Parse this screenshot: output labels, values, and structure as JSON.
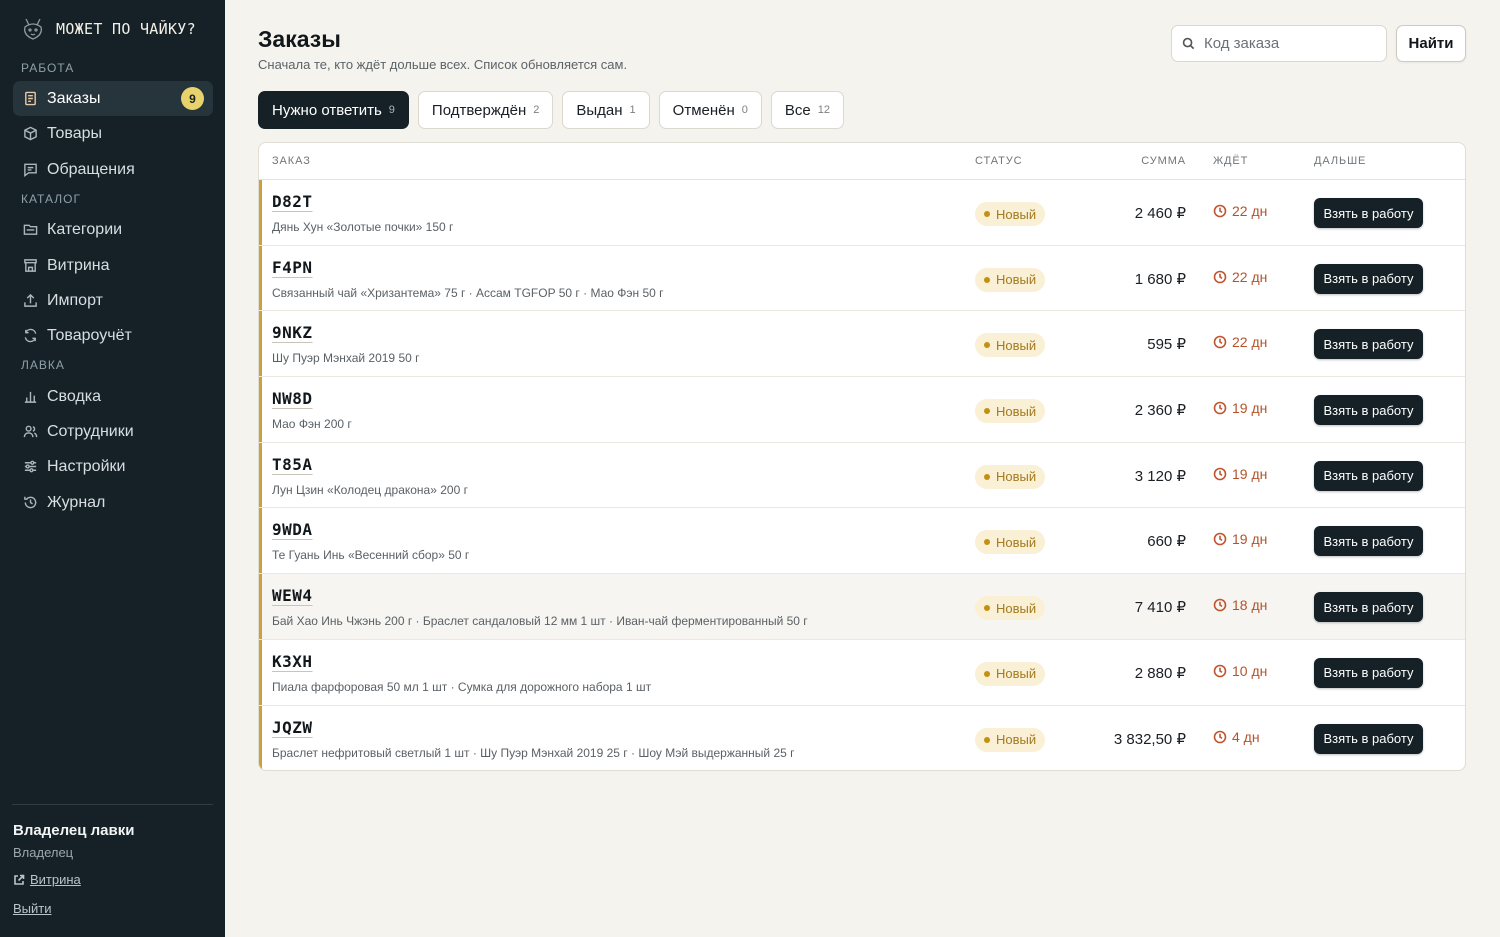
{
  "brand": {
    "name": "Может по чайку?"
  },
  "sidebar": {
    "sections": [
      {
        "title": "Работа"
      },
      {
        "title": "Каталог"
      },
      {
        "title": "Лавка"
      }
    ],
    "items": [
      {
        "label": "Заказы",
        "icon": "receipt-icon",
        "badge": "9",
        "active": true
      },
      {
        "label": "Товары",
        "icon": "box-icon"
      },
      {
        "label": "Обращения",
        "icon": "chat-icon"
      },
      {
        "label": "Категории",
        "icon": "folder-icon"
      },
      {
        "label": "Витрина",
        "icon": "storefront-icon"
      },
      {
        "label": "Импорт",
        "icon": "upload-icon"
      },
      {
        "label": "Товароучёт",
        "icon": "sync-icon"
      },
      {
        "label": "Сводка",
        "icon": "bar-chart-icon"
      },
      {
        "label": "Сотрудники",
        "icon": "users-icon"
      },
      {
        "label": "Настройки",
        "icon": "sliders-icon"
      },
      {
        "label": "Журнал",
        "icon": "history-icon"
      }
    ],
    "user": {
      "name": "Владелец лавки",
      "role": "Владелец"
    },
    "storefront_link": "Витрина",
    "logout_link": "Выйти"
  },
  "header": {
    "title": "Заказы",
    "subtitle": "Сначала те, кто ждёт дольше всех. Список обновляется сам.",
    "search_placeholder": "Код заказа",
    "search_button": "Найти"
  },
  "tabs": [
    {
      "label": "Нужно ответить",
      "count": "9",
      "active": true
    },
    {
      "label": "Подтверждён",
      "count": "2"
    },
    {
      "label": "Выдан",
      "count": "1"
    },
    {
      "label": "Отменён",
      "count": "0"
    },
    {
      "label": "Все",
      "count": "12"
    }
  ],
  "table": {
    "columns": {
      "order": "Заказ",
      "status": "Статус",
      "amount": "Сумма",
      "waiting": "Ждёт",
      "next": "Дальше"
    },
    "rows": [
      {
        "code": "D82T",
        "items": "Дянь Хун «Золотые почки» 150 г",
        "status": "Новый",
        "amount": "2 460 ₽",
        "waiting": "22 дн",
        "action": "Взять в работу"
      },
      {
        "code": "F4PN",
        "items": "Связанный чай «Хризантема» 75 г · Ассам TGFOP 50 г · Мао Фэн 50 г",
        "status": "Новый",
        "amount": "1 680 ₽",
        "waiting": "22 дн",
        "action": "Взять в работу"
      },
      {
        "code": "9NKZ",
        "items": "Шу Пуэр Мэнхай 2019 50 г",
        "status": "Новый",
        "amount": "595 ₽",
        "waiting": "22 дн",
        "action": "Взять в работу"
      },
      {
        "code": "NW8D",
        "items": "Мао Фэн 200 г",
        "status": "Новый",
        "amount": "2 360 ₽",
        "waiting": "19 дн",
        "action": "Взять в работу"
      },
      {
        "code": "T85A",
        "items": "Лун Цзин «Колодец дракона» 200 г",
        "status": "Новый",
        "amount": "3 120 ₽",
        "waiting": "19 дн",
        "action": "Взять в работу"
      },
      {
        "code": "9WDA",
        "items": "Те Гуань Инь «Весенний сбор» 50 г",
        "status": "Новый",
        "amount": "660 ₽",
        "waiting": "19 дн",
        "action": "Взять в работу"
      },
      {
        "code": "WEW4",
        "items": "Бай Хао Инь Чжэнь 200 г · Браслет сандаловый 12 мм 1 шт · Иван-чай ферментированный 50 г",
        "status": "Новый",
        "amount": "7 410 ₽",
        "waiting": "18 дн",
        "action": "Взять в работу"
      },
      {
        "code": "K3XH",
        "items": "Пиала фарфоровая 50 мл 1 шт · Сумка для дорожного набора 1 шт",
        "status": "Новый",
        "amount": "2 880 ₽",
        "waiting": "10 дн",
        "action": "Взять в работу"
      },
      {
        "code": "JQZW",
        "items": "Браслет нефритовый светлый 1 шт · Шу Пуэр Мэнхай 2019 25 г · Шоу Мэй выдержанный 25 г",
        "status": "Новый",
        "amount": "3 832,50 ₽",
        "waiting": "4 дн",
        "action": "Взять в работу"
      }
    ]
  },
  "colors": {
    "sidebar_bg": "#162127",
    "accent_badge": "#e8d26b",
    "status_new": "#c48f12",
    "waiting": "#b4532c"
  }
}
